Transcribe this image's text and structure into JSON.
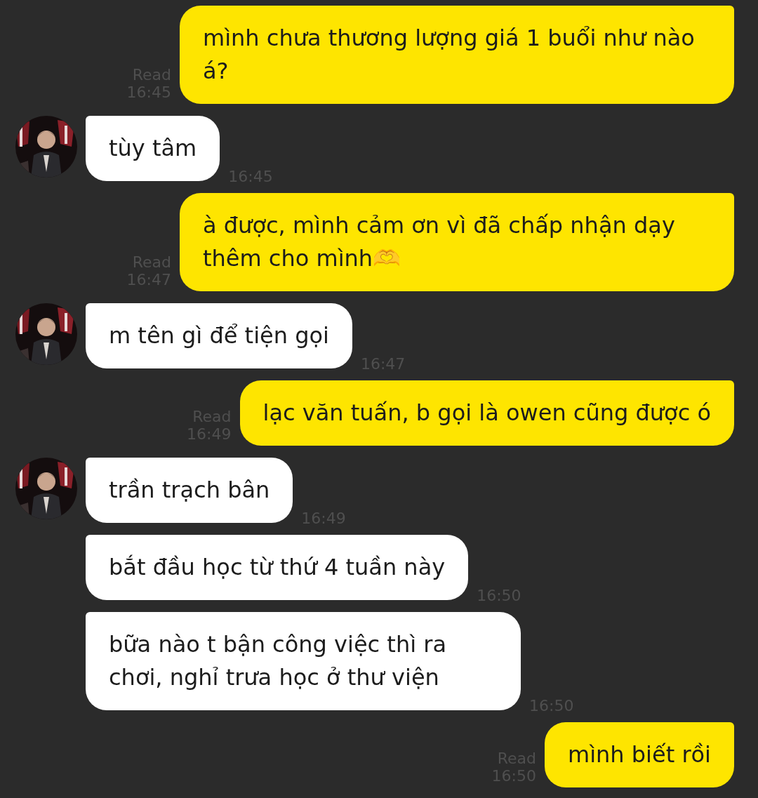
{
  "messages": [
    {
      "kind": "outgoing",
      "text": "mình chưa thương lượng giá 1 buổi như nào á?",
      "status": "Read",
      "time": "16:45"
    },
    {
      "kind": "incoming",
      "avatar": true,
      "text": "tùy tâm",
      "time": "16:45"
    },
    {
      "kind": "outgoing",
      "text": "à được, mình cảm ơn vì đã chấp nhận dạy thêm cho mình🫶",
      "status": "Read",
      "time": "16:47"
    },
    {
      "kind": "incoming",
      "avatar": true,
      "text": "m tên gì để tiện gọi",
      "time": "16:47"
    },
    {
      "kind": "outgoing",
      "text": "lạc văn tuấn, b gọi là owen cũng được ó",
      "status": "Read",
      "time": "16:49"
    },
    {
      "kind": "incoming",
      "avatar": true,
      "text": "trần trạch bân",
      "time": "16:49"
    },
    {
      "kind": "incoming",
      "avatar": false,
      "text": "bắt đầu học từ thứ 4 tuần này",
      "time": "16:50"
    },
    {
      "kind": "incoming",
      "avatar": false,
      "text": "bữa nào t bận công việc thì ra chơi, nghỉ trưa học ở thư viện",
      "time": "16:50"
    },
    {
      "kind": "outgoing",
      "text": "mình biết rồi",
      "status": "Read",
      "time": "16:50"
    }
  ]
}
